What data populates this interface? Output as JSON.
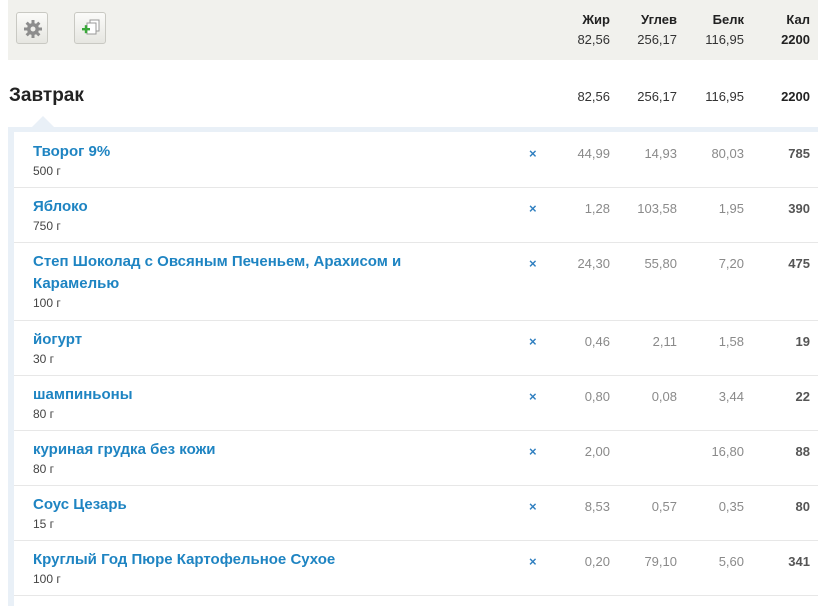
{
  "header": {
    "labels": {
      "fat": "Жир",
      "carbs": "Углев",
      "protein": "Белк",
      "kcal": "Кал"
    },
    "totals": {
      "fat": "82,56",
      "carbs": "256,17",
      "protein": "116,95",
      "kcal": "2200"
    }
  },
  "meal": {
    "title": "Завтрак",
    "totals": {
      "fat": "82,56",
      "carbs": "256,17",
      "protein": "116,95",
      "kcal": "2200"
    }
  },
  "items": [
    {
      "name": "Творог 9%",
      "amount": "500 г",
      "remove": "×",
      "fat": "44,99",
      "carbs": "14,93",
      "protein": "80,03",
      "kcal": "785"
    },
    {
      "name": "Яблоко",
      "amount": "750 г",
      "remove": "×",
      "fat": "1,28",
      "carbs": "103,58",
      "protein": "1,95",
      "kcal": "390"
    },
    {
      "name": "Степ Шоколад с Овсяным Печеньем, Арахисом и Карамелью",
      "amount": "100 г",
      "remove": "×",
      "fat": "24,30",
      "carbs": "55,80",
      "protein": "7,20",
      "kcal": "475"
    },
    {
      "name": "йогурт",
      "amount": "30 г",
      "remove": "×",
      "fat": "0,46",
      "carbs": "2,11",
      "protein": "1,58",
      "kcal": "19"
    },
    {
      "name": "шампиньоны",
      "amount": "80 г",
      "remove": "×",
      "fat": "0,80",
      "carbs": "0,08",
      "protein": "3,44",
      "kcal": "22"
    },
    {
      "name": "куриная грудка без кожи",
      "amount": "80 г",
      "remove": "×",
      "fat": "2,00",
      "carbs": "",
      "protein": "16,80",
      "kcal": "88"
    },
    {
      "name": "Соус Цезарь",
      "amount": "15 г",
      "remove": "×",
      "fat": "8,53",
      "carbs": "0,57",
      "protein": "0,35",
      "kcal": "80"
    },
    {
      "name": "Круглый Год Пюре Картофельное Сухое",
      "amount": "100 г",
      "remove": "×",
      "fat": "0,20",
      "carbs": "79,10",
      "protein": "5,60",
      "kcal": "341"
    }
  ]
}
